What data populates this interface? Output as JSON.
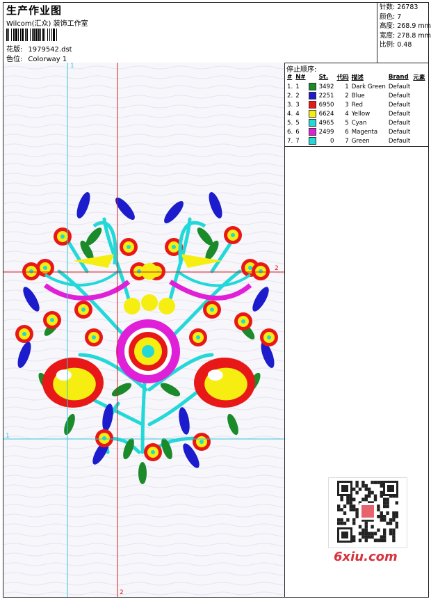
{
  "header": {
    "title": "生产作业图",
    "company": "Wilcom(汇众) 装饰工作室",
    "design_label": "花版:",
    "design_value": "1979542.dst",
    "color_label": "色位:",
    "color_value": "Colorway 1"
  },
  "stats": {
    "stitches": "针数: 26783",
    "colors": "颜色: 7",
    "height": "高度: 268.9 mm",
    "width": "宽度: 278.8 mm",
    "scale": "比例: 0.48"
  },
  "sequence": {
    "title": "停止顺序:",
    "columns": [
      "#",
      "N#",
      "St.",
      "代码",
      "描述",
      "Brand",
      "元素"
    ],
    "rows": [
      {
        "idx": "1.",
        "n": "1",
        "color": "#1a8a2a",
        "st": "3492",
        "code": "1",
        "desc": "Dark Green",
        "brand": "Default"
      },
      {
        "idx": "2.",
        "n": "2",
        "color": "#1c1ccc",
        "st": "2251",
        "code": "2",
        "desc": "Blue",
        "brand": "Default"
      },
      {
        "idx": "3.",
        "n": "3",
        "color": "#e81818",
        "st": "6950",
        "code": "3",
        "desc": "Red",
        "brand": "Default"
      },
      {
        "idx": "4.",
        "n": "4",
        "color": "#f5ee10",
        "st": "6624",
        "code": "4",
        "desc": "Yellow",
        "brand": "Default"
      },
      {
        "idx": "5.",
        "n": "5",
        "color": "#22d8d8",
        "st": "4965",
        "code": "5",
        "desc": "Cyan",
        "brand": "Default"
      },
      {
        "idx": "6.",
        "n": "6",
        "color": "#e020d8",
        "st": "2499",
        "code": "6",
        "desc": "Magenta",
        "brand": "Default"
      },
      {
        "idx": "7.",
        "n": "7",
        "color": "#22d8d8",
        "st": "0",
        "code": "7",
        "desc": "Green",
        "brand": "Default"
      }
    ]
  },
  "guides": {
    "v1": "1",
    "v2": "2",
    "h1": "1",
    "h2": "2"
  },
  "watermark": {
    "text": "6xiu.com"
  },
  "palette": {
    "red": "#e81818",
    "yellow": "#f5ee10",
    "cyan": "#22d8d8",
    "magenta": "#e020d8",
    "blue": "#1c1ccc",
    "green": "#1a8a2a",
    "guide_red": "#d81c1c",
    "guide_cyan": "#35c8d8"
  }
}
